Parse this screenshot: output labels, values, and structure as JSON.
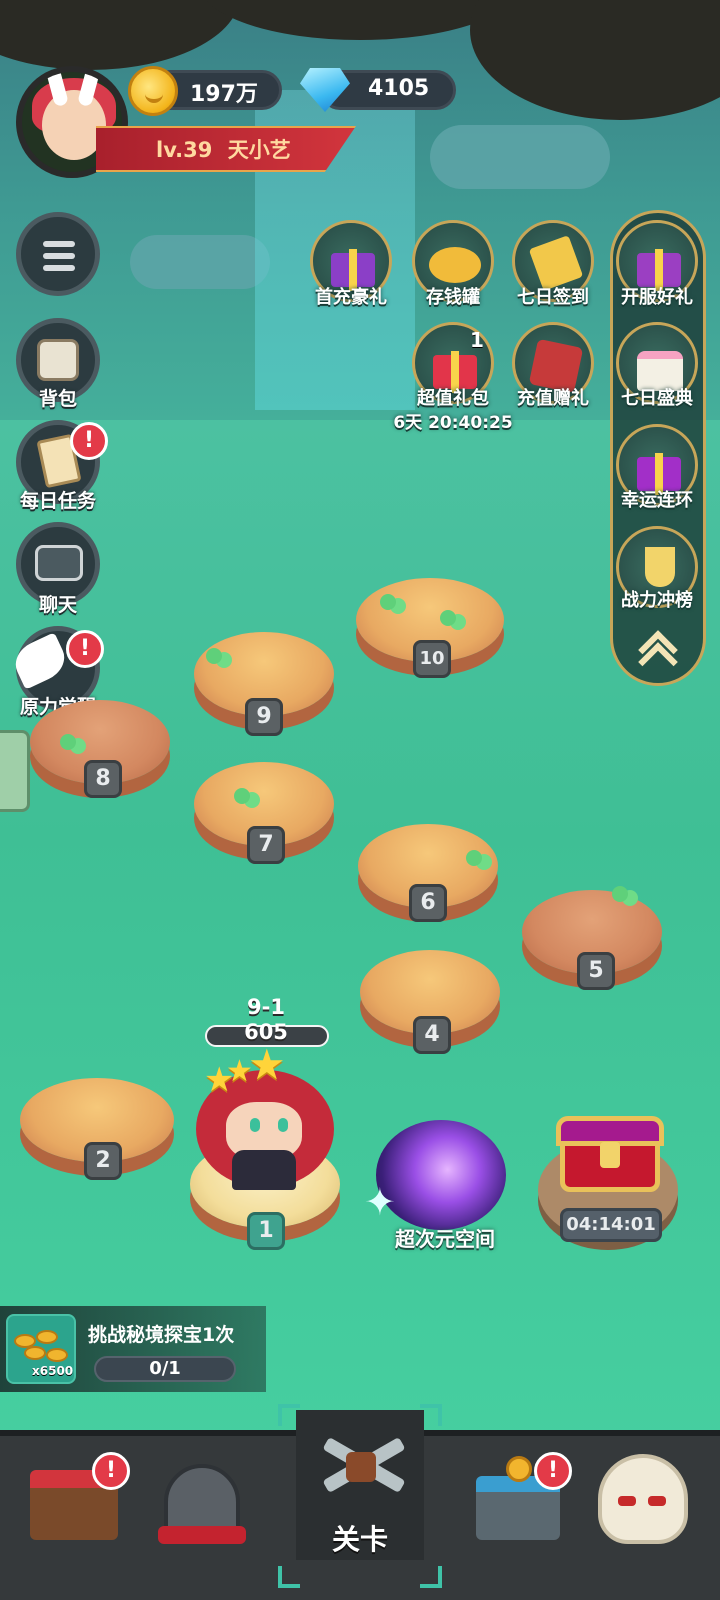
{
  "player": {
    "level": "lv.39",
    "name": "天小艺",
    "coins": "197万",
    "gems": "4105"
  },
  "left_menu": [
    {
      "label": "",
      "icon": "menu-icon",
      "alert": ""
    },
    {
      "label": "背包",
      "icon": "backpack-icon",
      "alert": ""
    },
    {
      "label": "每日任务",
      "icon": "clipboard-icon",
      "alert": "!"
    },
    {
      "label": "聊天",
      "icon": "chat-icon",
      "alert": ""
    },
    {
      "label": "原力觉醒",
      "icon": "wings-icon",
      "alert": "!"
    }
  ],
  "events": {
    "first_recharge": "首充豪礼",
    "piggy_bank": "存钱罐",
    "seven_day_checkin": "七日签到",
    "value_pack": "超值礼包",
    "value_pack_count": "1",
    "value_pack_timer": "6天 20:40:25",
    "recharge_gift": "充值赠礼"
  },
  "right_panel": {
    "server_gift": "开服好礼",
    "seven_day_event": "七日盛典",
    "lucky_chain": "幸运连环",
    "power_rank": "战力冲榜"
  },
  "stages": [
    "1",
    "2",
    "4",
    "5",
    "6",
    "7",
    "8",
    "9",
    "10"
  ],
  "current_stage": {
    "id": "9-1",
    "power": "605"
  },
  "portal": {
    "label": "超次元空间"
  },
  "chest": {
    "timer": "04:14:01"
  },
  "quest": {
    "title": "挑战秘境探宝1次",
    "progress": "0/1",
    "reward_count": "x6500"
  },
  "bottom_nav": {
    "center_label": "关卡",
    "shop_alert": "!",
    "treasure_alert": "!"
  },
  "colors": {
    "background": "#3fbf95",
    "accent_red": "#d2353d",
    "gold": "#c7a659",
    "alert": "#e33a48"
  }
}
